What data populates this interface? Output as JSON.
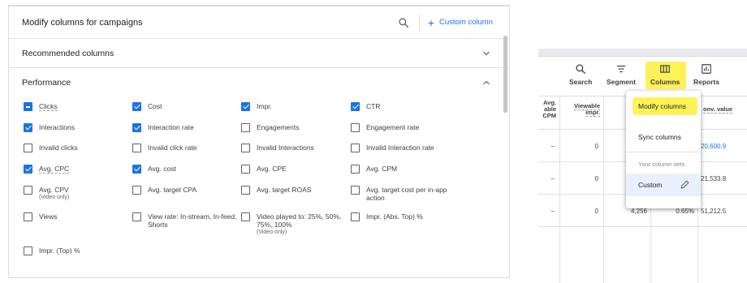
{
  "left_panel": {
    "title": "Modify columns for campaigns",
    "custom_column_label": "Custom column",
    "sections": {
      "recommended": "Recommended columns",
      "performance": "Performance"
    },
    "checkboxes": [
      {
        "label": "Clicks",
        "state": "indeterminate",
        "dashed": true
      },
      {
        "label": "Cost",
        "state": "checked"
      },
      {
        "label": "Impr.",
        "state": "checked"
      },
      {
        "label": "CTR",
        "state": "checked"
      },
      {
        "label": "Interactions",
        "state": "checked"
      },
      {
        "label": "Interaction rate",
        "state": "checked"
      },
      {
        "label": "Engagements",
        "state": "unchecked"
      },
      {
        "label": "Engagement rate",
        "state": "unchecked"
      },
      {
        "label": "Invalid clicks",
        "state": "unchecked"
      },
      {
        "label": "Invalid click rate",
        "state": "unchecked"
      },
      {
        "label": "Invalid Interactions",
        "state": "unchecked"
      },
      {
        "label": "Invalid Interaction rate",
        "state": "unchecked"
      },
      {
        "label": "Avg. CPC",
        "state": "checked",
        "dashed": true
      },
      {
        "label": "Avg. cost",
        "state": "checked"
      },
      {
        "label": "Avg. CPE",
        "state": "unchecked"
      },
      {
        "label": "Avg. CPM",
        "state": "unchecked"
      },
      {
        "label": "Avg. CPV",
        "sub": "(Video only)",
        "state": "unchecked"
      },
      {
        "label": "Avg. target CPA",
        "state": "unchecked"
      },
      {
        "label": "Avg. target ROAS",
        "state": "unchecked"
      },
      {
        "label": "Avg. target cost per in-app action",
        "state": "unchecked"
      },
      {
        "label": "Views",
        "state": "unchecked"
      },
      {
        "label": "View rate: In-stream, In-feed, Shorts",
        "state": "unchecked"
      },
      {
        "label": "Video played to: 25%, 50%, 75%, 100%",
        "sub": "(Video only)",
        "state": "unchecked"
      },
      {
        "label": "Impr. (Abs. Top) %",
        "state": "unchecked"
      },
      {
        "label": "Impr. (Top) %",
        "state": "unchecked"
      }
    ]
  },
  "right_panel": {
    "toolbar": [
      {
        "label": "Search",
        "icon": "search-icon"
      },
      {
        "label": "Segment",
        "icon": "segment-icon"
      },
      {
        "label": "Columns",
        "icon": "columns-icon"
      },
      {
        "label": "Reports",
        "icon": "reports-icon"
      }
    ],
    "headers": {
      "avg_cpm": [
        "Avg.",
        "able",
        "CPM"
      ],
      "viewable_impr": [
        "Viewable",
        "impr."
      ],
      "conv_value": "onv. value"
    },
    "rows": [
      {
        "c1": "–",
        "c2": "0",
        "c3": "",
        "c4": "",
        "c5": "20,600.9"
      },
      {
        "c1": "–",
        "c2": "0",
        "c3": "",
        "c4": "",
        "c5": "21,533.8"
      },
      {
        "c1": "–",
        "c2": "0",
        "c3": "4,256",
        "c4": "0.65%",
        "c5": "51,212.5"
      }
    ],
    "menu": {
      "modify_columns": "Modify columns",
      "sync_columns": "Sync columns",
      "column_sets_heading": "Your column sets",
      "custom": "Custom"
    },
    "highlight_color": "#fff03b",
    "accent_color": "#1a73e8"
  }
}
